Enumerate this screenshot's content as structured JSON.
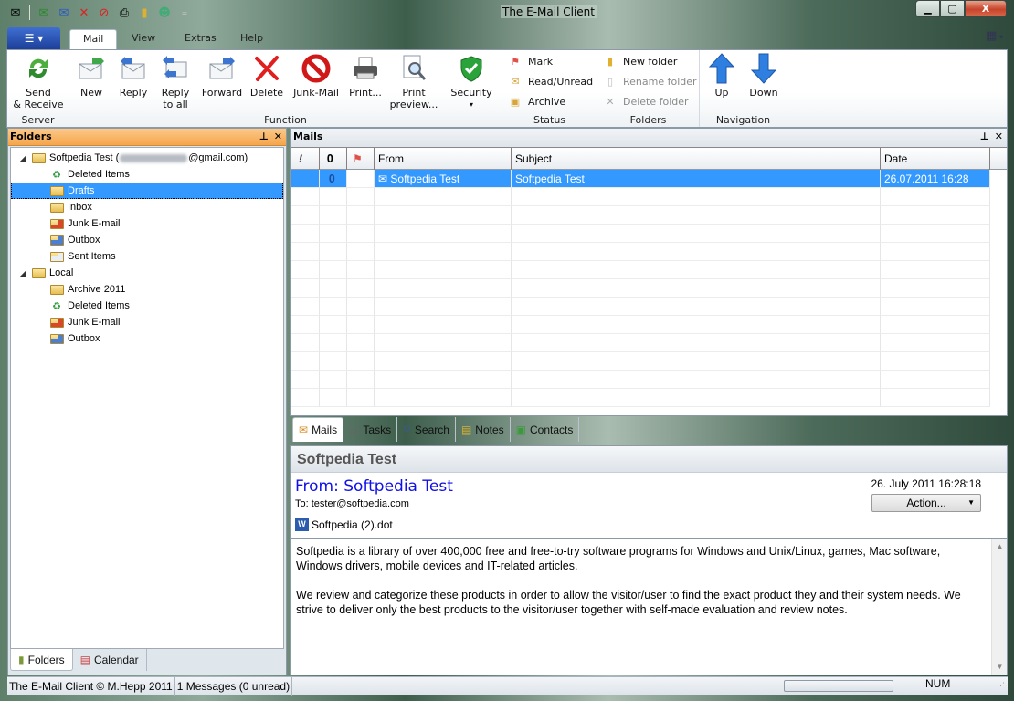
{
  "window": {
    "title": "The E-Mail Client",
    "controls": {
      "minimize": "—",
      "maximize": "▢",
      "close": "X"
    }
  },
  "quick_access": [
    "compose-icon",
    "send-receive-icon",
    "reply-icon",
    "delete-icon",
    "junk-icon",
    "print-icon",
    "new-folder-icon",
    "contacts-icon"
  ],
  "ribbon_tabs": [
    {
      "label": "Mail",
      "active": true
    },
    {
      "label": "View",
      "active": false
    },
    {
      "label": "Extras",
      "active": false
    },
    {
      "label": "Help",
      "active": false
    }
  ],
  "ribbon": {
    "groups": {
      "server": "Server",
      "function": "Function",
      "status": "Status",
      "folders": "Folders",
      "navigation": "Navigation"
    },
    "server_buttons": [
      {
        "label": "Send\n& Receive",
        "line1": "Send",
        "line2": "& Receive"
      }
    ],
    "function_buttons": [
      {
        "line1": "New",
        "line2": ""
      },
      {
        "line1": "Reply",
        "line2": ""
      },
      {
        "line1": "Reply",
        "line2": "to all"
      },
      {
        "line1": "Forward",
        "line2": ""
      },
      {
        "line1": "Delete",
        "line2": ""
      },
      {
        "line1": "Junk-Mail",
        "line2": ""
      },
      {
        "line1": "Print...",
        "line2": ""
      },
      {
        "line1": "Print",
        "line2": "preview..."
      },
      {
        "line1": "Security",
        "line2": "▾"
      }
    ],
    "status_buttons": [
      {
        "label": "Mark",
        "enabled": true
      },
      {
        "label": "Read/Unread",
        "enabled": true
      },
      {
        "label": "Archive",
        "enabled": true
      }
    ],
    "folder_buttons": [
      {
        "label": "New folder",
        "enabled": true
      },
      {
        "label": "Rename folder",
        "enabled": false
      },
      {
        "label": "Delete folder",
        "enabled": false
      }
    ],
    "navigation_buttons": [
      {
        "label": "Up"
      },
      {
        "label": "Down"
      }
    ]
  },
  "folders_panel": {
    "title": "Folders",
    "pin": "📌",
    "close": "✕",
    "tree": [
      {
        "label_prefix": "Softpedia Test (",
        "label_suffix": "@gmail.com)",
        "level": 0,
        "icon": "folder-icon",
        "expanded": true
      },
      {
        "label": "Deleted Items",
        "level": 1,
        "icon": "deleted-items-icon"
      },
      {
        "label": "Drafts",
        "level": 1,
        "icon": "drafts-icon",
        "selected": true
      },
      {
        "label": "Inbox",
        "level": 1,
        "icon": "inbox-icon"
      },
      {
        "label": "Junk E-mail",
        "level": 1,
        "icon": "junk-folder-icon"
      },
      {
        "label": "Outbox",
        "level": 1,
        "icon": "outbox-icon"
      },
      {
        "label": "Sent Items",
        "level": 1,
        "icon": "sent-items-icon"
      },
      {
        "label": "Local",
        "level": 0,
        "icon": "folder-icon",
        "expanded": true
      },
      {
        "label": "Archive 2011",
        "level": 1,
        "icon": "folder-icon"
      },
      {
        "label": "Deleted Items",
        "level": 1,
        "icon": "deleted-items-icon"
      },
      {
        "label": "Junk E-mail",
        "level": 1,
        "icon": "junk-folder-icon"
      },
      {
        "label": "Outbox",
        "level": 1,
        "icon": "outbox-icon"
      }
    ],
    "bottom_tabs": [
      {
        "label": "Folders",
        "active": true
      },
      {
        "label": "Calendar",
        "active": false
      }
    ]
  },
  "mails_panel": {
    "title": "Mails",
    "columns": [
      "!",
      "attachment",
      "flag",
      "From",
      "Subject",
      "Date"
    ],
    "rows": [
      {
        "priority": "",
        "attachment": true,
        "flag": "",
        "from": "Softpedia Test",
        "subject": "Softpedia Test",
        "date": "26.07.2011 16:28",
        "selected": true
      }
    ]
  },
  "module_tabs": [
    {
      "label": "Mails",
      "active": true
    },
    {
      "label": "Tasks",
      "active": false
    },
    {
      "label": "Search",
      "active": false
    },
    {
      "label": "Notes",
      "active": false
    },
    {
      "label": "Contacts",
      "active": false
    }
  ],
  "preview": {
    "subject": "Softpedia Test",
    "from": "From: Softpedia Test",
    "to": "To: tester@softpedia.com",
    "date": "26. July 2011 16:28:18",
    "action_label": "Action...",
    "attachment": "Softpedia (2).dot",
    "body": [
      "Softpedia is a library of over 400,000 free and free-to-try software programs for Windows and Unix/Linux, games, Mac software, Windows drivers, mobile devices and IT-related articles.",
      "We review and categorize these products in order to allow the visitor/user to find the exact product they and their system needs. We strive to deliver only the best products to the visitor/user together with self-made evaluation and review notes."
    ]
  },
  "statusbar": {
    "copyright": "The E-Mail Client © M.Hepp 2011",
    "messages": "1 Messages (0 unread)",
    "progress": 0,
    "num": "NUM"
  },
  "colors": {
    "selection": "#3399ff",
    "folders_header": "#f6a54a",
    "from_link": "#1010e8"
  }
}
